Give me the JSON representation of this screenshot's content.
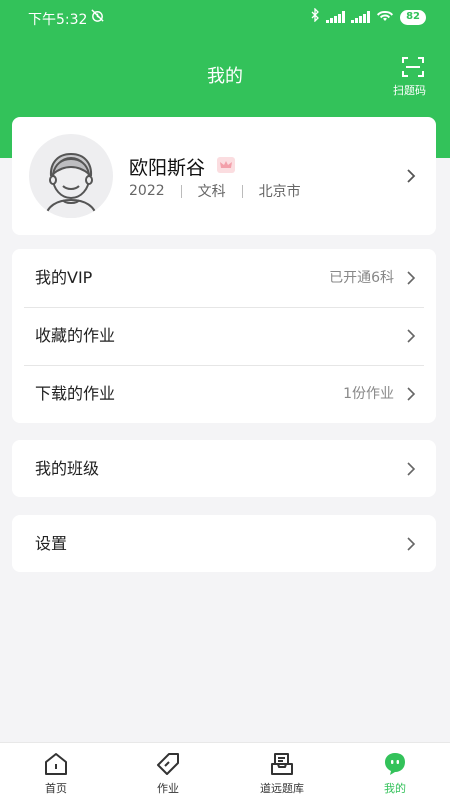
{
  "status_bar": {
    "time": "下午5:32",
    "battery": "82"
  },
  "header": {
    "title": "我的",
    "scan_label": "扫题码"
  },
  "profile": {
    "name": "欧阳斯谷",
    "year": "2022",
    "subject": "文科",
    "city": "北京市"
  },
  "menu_group_1": [
    {
      "label": "我的VIP",
      "value": "已开通6科"
    },
    {
      "label": "收藏的作业",
      "value": ""
    },
    {
      "label": "下载的作业",
      "value": "1份作业"
    }
  ],
  "menu_group_2": {
    "label": "我的班级"
  },
  "menu_group_3": {
    "label": "设置"
  },
  "tabbar": [
    {
      "label": "首页",
      "icon": "home-icon"
    },
    {
      "label": "作业",
      "icon": "tag-icon"
    },
    {
      "label": "道远题库",
      "icon": "question-bank-icon"
    },
    {
      "label": "我的",
      "icon": "mine-icon"
    }
  ],
  "colors": {
    "accent": "#33c25a",
    "background": "#f4f4f6"
  }
}
